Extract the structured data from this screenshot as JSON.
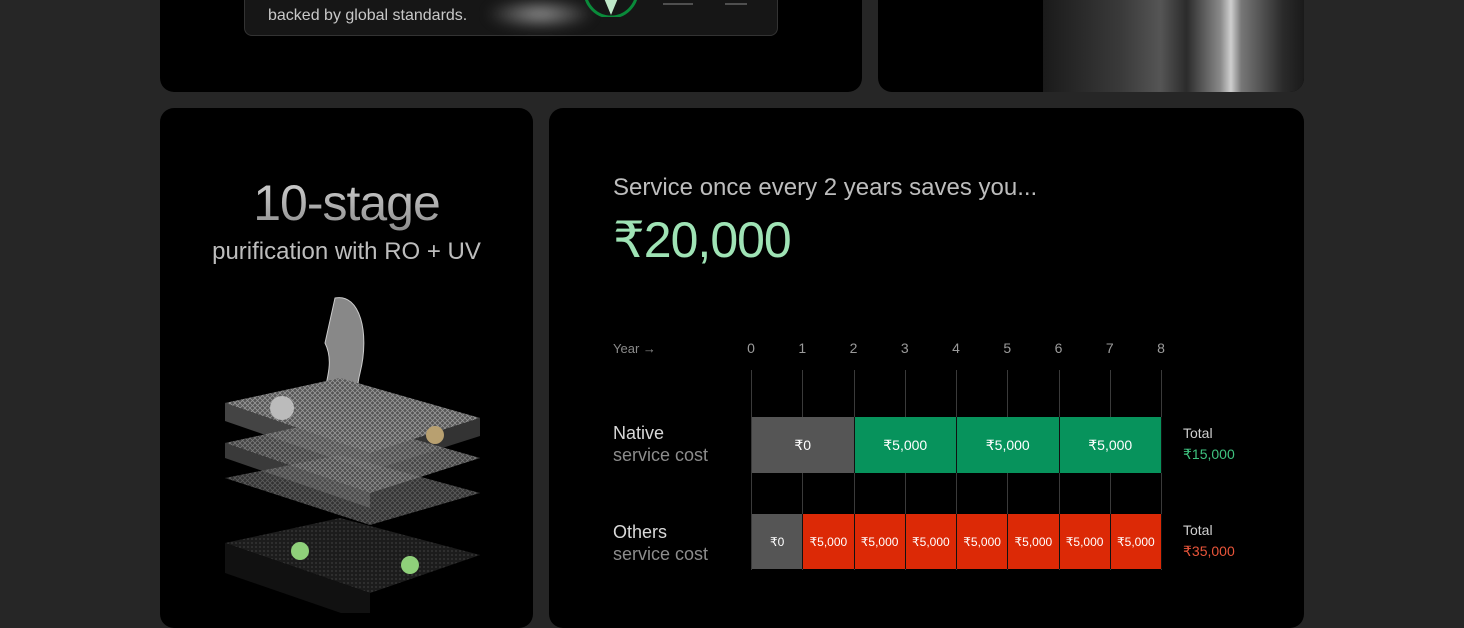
{
  "certification_card": {
    "text": "backed by global standards."
  },
  "purification_card": {
    "title": "10-stage",
    "subtitle": "purification with RO + UV"
  },
  "savings_card": {
    "heading": "Service once every 2 years saves you...",
    "amount": "₹20,000",
    "year_label": "Year →",
    "years": [
      "0",
      "1",
      "2",
      "3",
      "4",
      "5",
      "6",
      "7",
      "8"
    ],
    "rows": [
      {
        "name_line1": "Native",
        "name_line2": "service cost",
        "segments": [
          {
            "label": "₹0",
            "from": 0,
            "to": 2,
            "color": "#555555"
          },
          {
            "label": "₹5,000",
            "from": 2,
            "to": 4,
            "color": "#07935c"
          },
          {
            "label": "₹5,000",
            "from": 4,
            "to": 6,
            "color": "#07935c"
          },
          {
            "label": "₹5,000",
            "from": 6,
            "to": 8,
            "color": "#07935c"
          }
        ],
        "total_label": "Total",
        "total_value": "₹15,000",
        "total_color": "#3fc27f"
      },
      {
        "name_line1": "Others",
        "name_line2": "service cost",
        "segments": [
          {
            "label": "₹0",
            "from": 0,
            "to": 1,
            "color": "#555555"
          },
          {
            "label": "₹5,000",
            "from": 1,
            "to": 2,
            "color": "#dc2906"
          },
          {
            "label": "₹5,000",
            "from": 2,
            "to": 3,
            "color": "#dc2906"
          },
          {
            "label": "₹5,000",
            "from": 3,
            "to": 4,
            "color": "#dc2906"
          },
          {
            "label": "₹5,000",
            "from": 4,
            "to": 5,
            "color": "#dc2906"
          },
          {
            "label": "₹5,000",
            "from": 5,
            "to": 6,
            "color": "#dc2906"
          },
          {
            "label": "₹5,000",
            "from": 6,
            "to": 7,
            "color": "#dc2906"
          },
          {
            "label": "₹5,000",
            "from": 7,
            "to": 8,
            "color": "#dc2906"
          }
        ],
        "total_label": "Total",
        "total_value": "₹35,000",
        "total_color": "#e8553a"
      }
    ]
  }
}
